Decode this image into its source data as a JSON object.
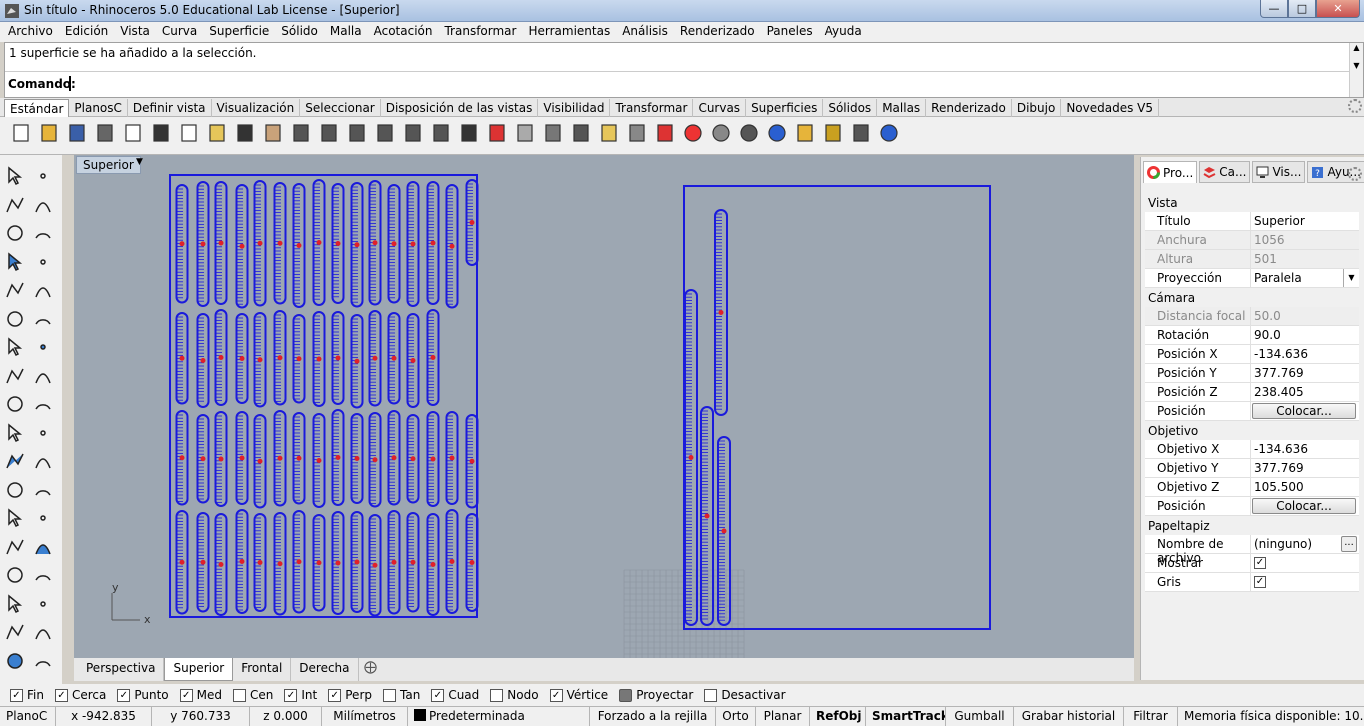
{
  "window": {
    "title": "Sin título - Rhinoceros 5.0 Educational Lab License - [Superior]"
  },
  "menu": [
    "Archivo",
    "Edición",
    "Vista",
    "Curva",
    "Superficie",
    "Sólido",
    "Malla",
    "Acotación",
    "Transformar",
    "Herramientas",
    "Análisis",
    "Renderizado",
    "Paneles",
    "Ayuda"
  ],
  "command": {
    "history": "1 superficie se ha añadido a la selección.",
    "prompt": "Comando:"
  },
  "toolbar_tabs": [
    "Estándar",
    "PlanosC",
    "Definir vista",
    "Visualización",
    "Seleccionar",
    "Disposición de las vistas",
    "Visibilidad",
    "Transformar",
    "Curvas",
    "Superficies",
    "Sólidos",
    "Mallas",
    "Renderizado",
    "Dibujo",
    "Novedades V5"
  ],
  "toolbar_icons": [
    "new-icon",
    "open-icon",
    "save-icon",
    "print-icon",
    "import-icon",
    "cut-icon",
    "copy-icon",
    "paste-icon",
    "undo-icon",
    "pan-icon",
    "rotate-view-icon",
    "zoom-dynamic-icon",
    "zoom-window-icon",
    "zoom-extents-icon",
    "zoom-selected-icon",
    "undo-view-icon",
    "four-viewports-icon",
    "car-icon",
    "point-off-icon",
    "grid-snap-icon",
    "select-objects-icon",
    "light-icon",
    "lock-icon",
    "layer-icon",
    "color-wheel-icon",
    "render-sphere-icon",
    "render-sphere2-icon",
    "render-blue-icon",
    "filter-icon",
    "options-icon",
    "mesh-tools-icon",
    "help-icon"
  ],
  "viewport": {
    "name": "Superior",
    "axis_y": "y",
    "axis_x": "x",
    "tabs": [
      "Perspectiva",
      "Superior",
      "Frontal",
      "Derecha"
    ],
    "active_tab": "Superior"
  },
  "panel": {
    "tabs": [
      "Pro...",
      "Ca...",
      "Vis...",
      "Ayu..."
    ],
    "sections": {
      "vista": "Vista",
      "camara": "Cámara",
      "objetivo": "Objetivo",
      "papeltapiz": "Papeltapiz"
    },
    "vista": {
      "titulo": {
        "label": "Título",
        "value": "Superior"
      },
      "anchura": {
        "label": "Anchura",
        "value": "1056"
      },
      "altura": {
        "label": "Altura",
        "value": "501"
      },
      "proyeccion": {
        "label": "Proyección",
        "value": "Paralela"
      }
    },
    "camara": {
      "distancia": {
        "label": "Distancia focal",
        "value": "50.0"
      },
      "rotacion": {
        "label": "Rotación",
        "value": "90.0"
      },
      "px": {
        "label": "Posición X",
        "value": "-134.636"
      },
      "py": {
        "label": "Posición Y",
        "value": "377.769"
      },
      "pz": {
        "label": "Posición Z",
        "value": "238.405"
      },
      "pos": {
        "label": "Posición",
        "button": "Colocar..."
      }
    },
    "objetivo": {
      "ox": {
        "label": "Objetivo X",
        "value": "-134.636"
      },
      "oy": {
        "label": "Objetivo Y",
        "value": "377.769"
      },
      "oz": {
        "label": "Objetivo Z",
        "value": "105.500"
      },
      "pos": {
        "label": "Posición",
        "button": "Colocar..."
      }
    },
    "papel": {
      "archivo": {
        "label": "Nombre de archivo",
        "value": "(ninguno)",
        "button": "..."
      },
      "mostrar": {
        "label": "Mostrar",
        "checked": true
      },
      "gris": {
        "label": "Gris",
        "checked": true
      }
    }
  },
  "osnaps": [
    {
      "label": "Fin",
      "checked": true
    },
    {
      "label": "Cerca",
      "checked": true
    },
    {
      "label": "Punto",
      "checked": true
    },
    {
      "label": "Med",
      "checked": true
    },
    {
      "label": "Cen",
      "checked": false
    },
    {
      "label": "Int",
      "checked": true
    },
    {
      "label": "Perp",
      "checked": true
    },
    {
      "label": "Tan",
      "checked": false
    },
    {
      "label": "Cuad",
      "checked": true
    },
    {
      "label": "Nodo",
      "checked": false
    },
    {
      "label": "Vértice",
      "checked": true
    },
    {
      "label": "Proyectar",
      "checked": false
    },
    {
      "label": "Desactivar",
      "checked": false
    }
  ],
  "status": {
    "cplane": "PlanoC",
    "x": "x -942.835",
    "y": "y 760.733",
    "z": "z 0.000",
    "units": "Milímetros",
    "layer": "Predeterminada",
    "grid_snap": "Forzado a la rejilla",
    "ortho": "Orto",
    "planar": "Planar",
    "osnap": "RefObj",
    "smarttrack": "SmartTrack",
    "gumball": "Gumball",
    "history": "Grabar historial",
    "filter": "Filtrar",
    "memory": "Memoria física disponible: 10..."
  },
  "colors": {
    "curves": "#1a1adc",
    "points": "#e0202a",
    "viewport_bg": "#9da7b2"
  }
}
